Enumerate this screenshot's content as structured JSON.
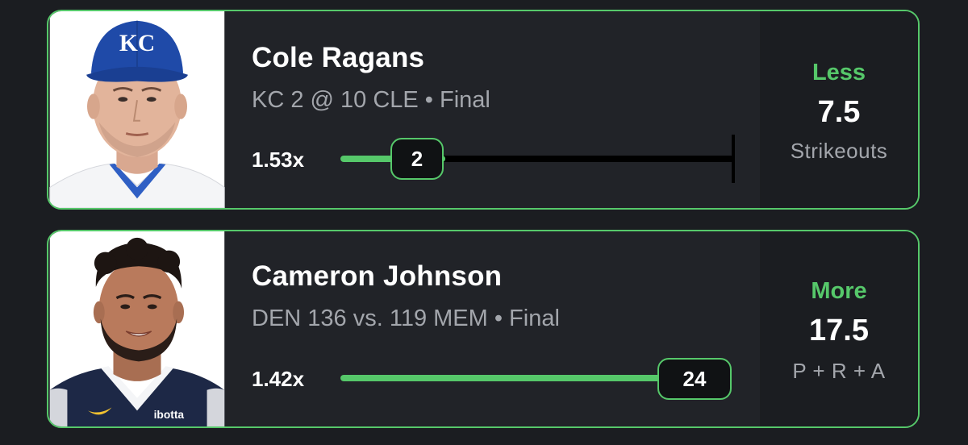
{
  "picks": [
    {
      "player": "Cole Ragans",
      "game": "KC 2 @ 10 CLE • Final",
      "multiplier": "1.53x",
      "actual": "2",
      "progress": 0.267,
      "direction": "Less",
      "line": "7.5",
      "stat": "Strikeouts",
      "cap_logo": "KC",
      "team_colors": {
        "cap": "#1f4aa8",
        "jersey": "#f4f5f7",
        "trim": "#2f5fc4"
      }
    },
    {
      "player": "Cameron Johnson",
      "game": "DEN 136 vs. 119 MEM • Final",
      "multiplier": "1.42x",
      "actual": "24",
      "progress": 1.0,
      "direction": "More",
      "line": "17.5",
      "stat": "P + R + A",
      "jersey_text": "ibotta",
      "team_colors": {
        "jersey": "#1d2846",
        "trim": "#f4f5f7"
      }
    }
  ],
  "colors": {
    "accent": "#56c86a",
    "background": "#1b1d21",
    "card": "#212328",
    "muted": "#a3a6ac"
  }
}
